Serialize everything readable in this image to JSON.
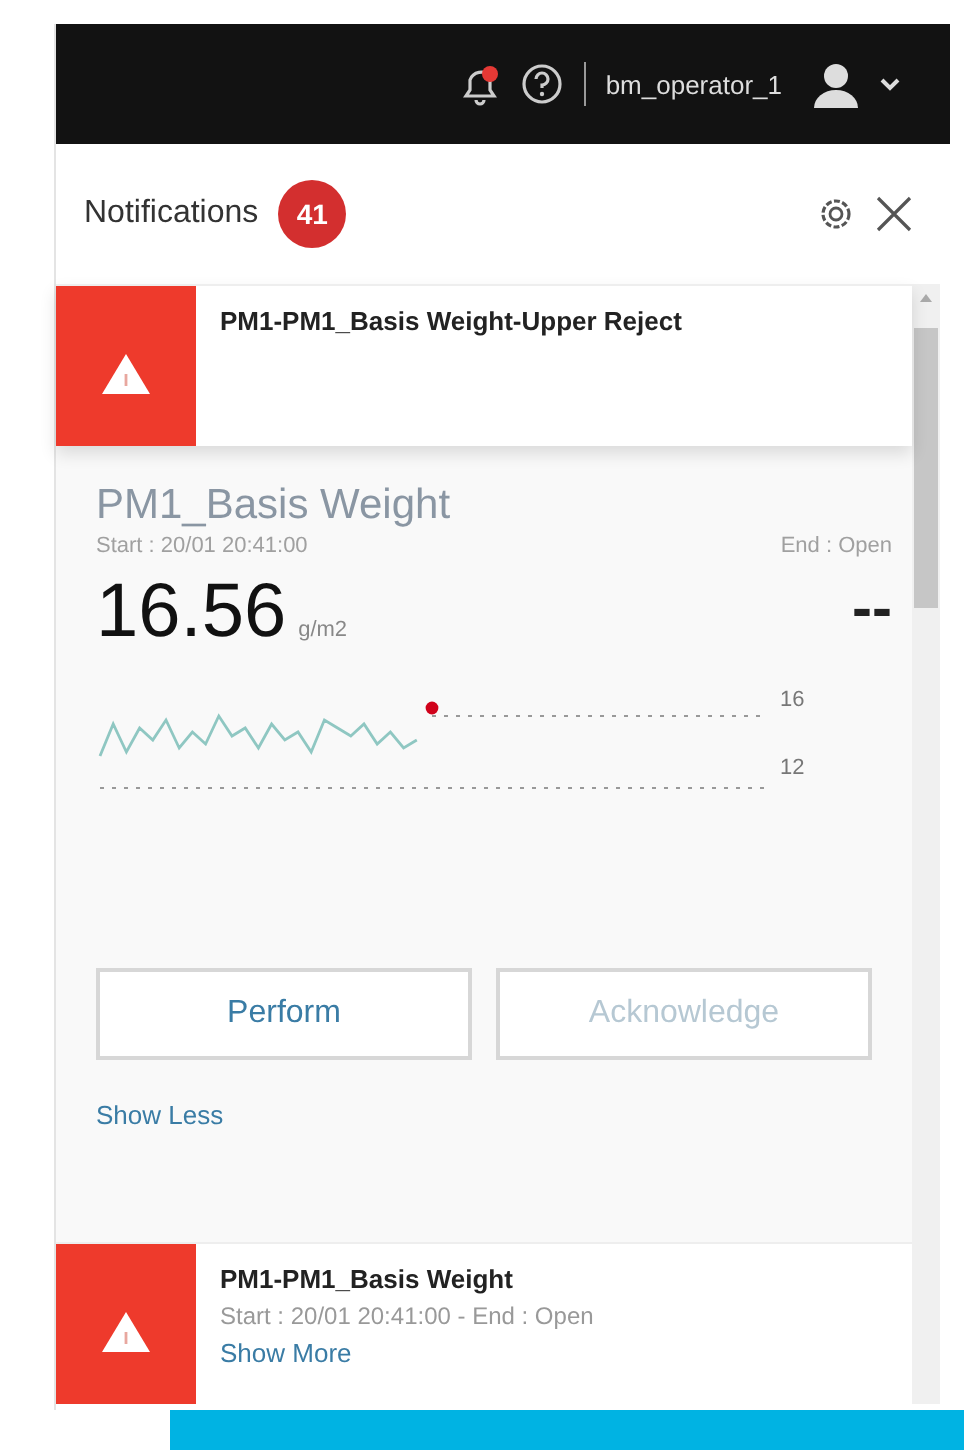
{
  "header": {
    "username": "bm_operator_1"
  },
  "notifications_panel": {
    "title": "Notifications",
    "count": "41",
    "items": [
      {
        "title": "PM1-PM1_Basis Weight-Upper Reject",
        "expanded": true,
        "detail": {
          "name": "PM1_Basis Weight",
          "start": "Start : 20/01 20:41:00",
          "end": "End : Open",
          "value": "16.56",
          "unit": "g/m2",
          "target": "--",
          "sparkline_labels": [
            "16",
            "12"
          ],
          "actions": [
            {
              "label": "Perform",
              "disabled": false
            },
            {
              "label": "Acknowledge",
              "disabled": true
            }
          ]
        },
        "toggle": "Show Less"
      },
      {
        "title": "PM1-PM1_Basis Weight",
        "expanded": false,
        "meta": "Start : 20/01 20:41:00  -  End : Open",
        "toggle": "Show More"
      }
    ]
  }
}
